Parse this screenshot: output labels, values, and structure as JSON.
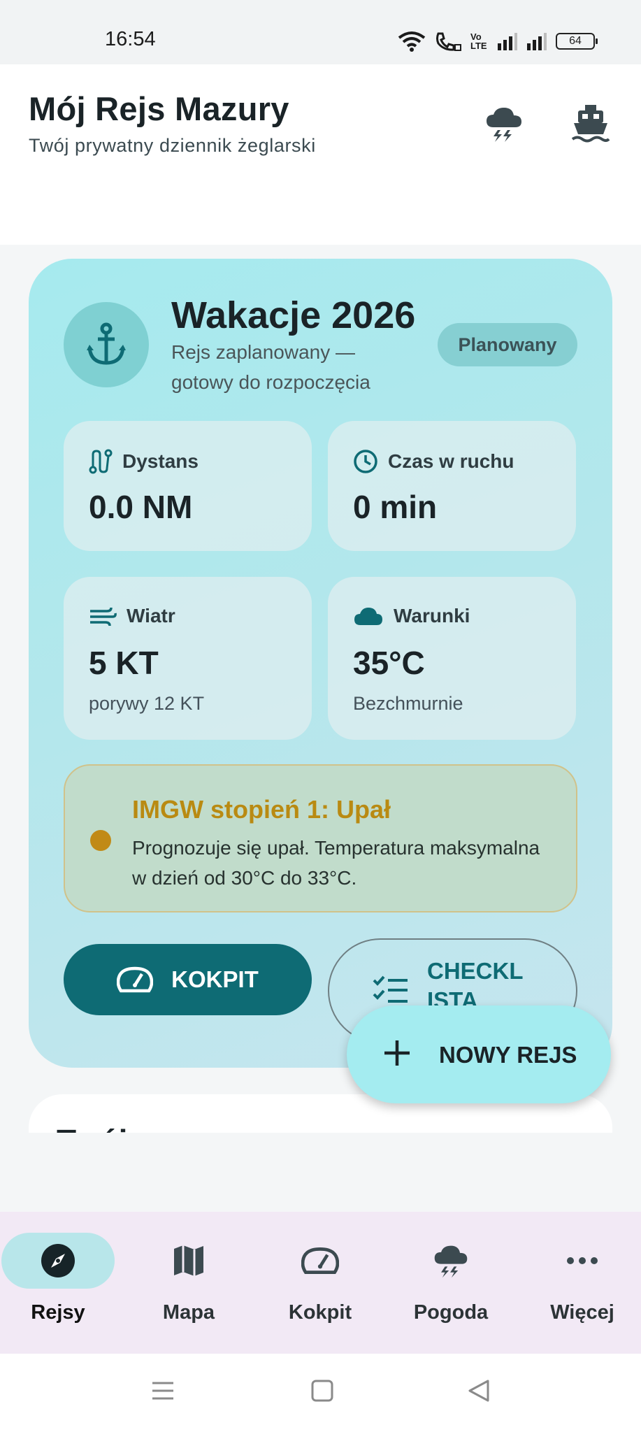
{
  "status_bar": {
    "time": "16:54",
    "battery": "64",
    "volte": "Vo LTE"
  },
  "header": {
    "title": "Mój Rejs Mazury",
    "subtitle": "Twój prywatny dziennik żeglarski",
    "icons": [
      "storm-cloud-icon",
      "ship-icon"
    ]
  },
  "trip": {
    "name": "Wakacje 2026",
    "description": "Rejs zaplanowany — gotowy do rozpoczęcia",
    "status": "Planowany",
    "stats": {
      "distance": {
        "label": "Dystans",
        "value": "0.0 NM"
      },
      "time": {
        "label": "Czas w ruchu",
        "value": "0 min"
      },
      "wind": {
        "label": "Wiatr",
        "value": "5 KT",
        "sub": "porywy 12 KT"
      },
      "conditions": {
        "label": "Warunki",
        "value": "35°C",
        "sub": "Bezchmurnie"
      }
    },
    "alert": {
      "title": "IMGW stopień 1: Upał",
      "text": "Prognozuje się upał. Temperatura maksymalna w dzień od 30°C do 33°C.",
      "color": "#c18a16"
    },
    "actions": {
      "kokpit": "KOKPIT",
      "checklist": "CHECKLISTA"
    }
  },
  "next_card_peek": "Twój",
  "fab": {
    "label": "NOWY REJS"
  },
  "bottom_nav": [
    {
      "label": "Rejsy",
      "icon": "compass-icon",
      "active": true
    },
    {
      "label": "Mapa",
      "icon": "map-icon",
      "active": false
    },
    {
      "label": "Kokpit",
      "icon": "speedometer-icon",
      "active": false
    },
    {
      "label": "Pogoda",
      "icon": "storm-cloud-icon",
      "active": false
    },
    {
      "label": "Więcej",
      "icon": "more-icon",
      "active": false
    }
  ],
  "colors": {
    "accent": "#0e6b74",
    "card": "#a6eaee",
    "fab": "#a4ecf0",
    "nav_bg": "#f2e9f5",
    "alert_title": "#b98a12"
  }
}
